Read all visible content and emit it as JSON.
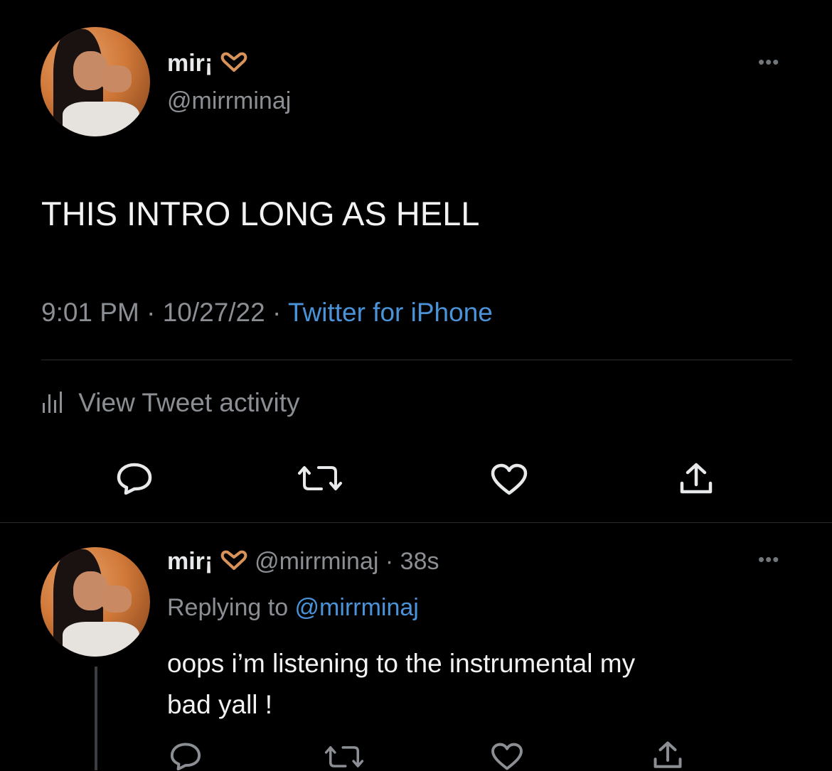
{
  "tweet": {
    "display_name": "mir¡",
    "handle": "@mirrminaj",
    "text": "THIS INTRO LONG AS HELL",
    "time": "9:01 PM",
    "separator": " · ",
    "date": "10/27/22",
    "source": "Twitter for iPhone",
    "activity_label": "View Tweet activity"
  },
  "reply": {
    "display_name": "mir¡",
    "handle": "@mirrminaj",
    "age": "· 38s",
    "replying_prefix": "Replying to ",
    "replying_handle": "@mirrminaj",
    "text_line1": "oops i’m listening to the instrumental my",
    "text_line2": "bad yall !"
  },
  "icons": [
    "heart-hands-emoji",
    "more-icon",
    "activity-bars-icon",
    "reply-icon",
    "retweet-icon",
    "like-icon",
    "share-icon"
  ],
  "colors": {
    "background": "#000000",
    "text": "#e7e9ea",
    "muted": "#8b8f94",
    "link": "#4a93d8"
  }
}
